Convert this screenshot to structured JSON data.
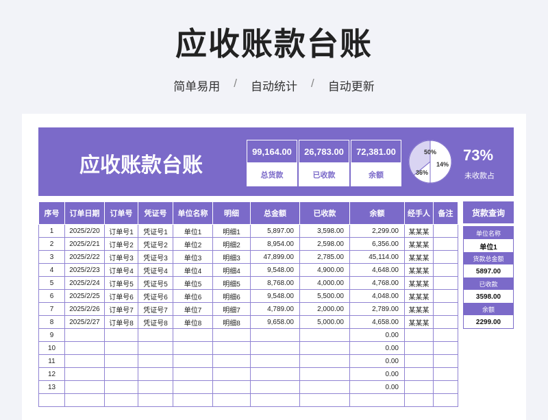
{
  "page": {
    "title": "应收账款台账",
    "subtitle": [
      "简单易用",
      "/",
      "自动统计",
      "/",
      "自动更新"
    ]
  },
  "colors": {
    "accent": "#7b6ac9",
    "grid": "#8f82d2",
    "pie_light": "#d9d4f2"
  },
  "banner": {
    "title": "应收账款台账",
    "stats": [
      {
        "value": "99,164.00",
        "label": "总货款"
      },
      {
        "value": "26,783.00",
        "label": "已收款"
      },
      {
        "value": "72,381.00",
        "label": "余额"
      }
    ],
    "pie": {
      "slices": [
        {
          "label": "50%",
          "value": 50
        },
        {
          "label": "14%",
          "value": 14
        },
        {
          "label": "36%",
          "value": 36
        }
      ]
    },
    "percent": "73%",
    "percent_label": "未收款占"
  },
  "table": {
    "headers": [
      "序号",
      "订单日期",
      "订单号",
      "凭证号",
      "单位名称",
      "明细",
      "总金额",
      "已收款",
      "余额",
      "经手人",
      "备注"
    ],
    "rows": [
      [
        "1",
        "2025/2/20",
        "订单号1",
        "凭证号1",
        "单位1",
        "明细1",
        "5,897.00",
        "3,598.00",
        "2,299.00",
        "某某某",
        ""
      ],
      [
        "2",
        "2025/2/21",
        "订单号2",
        "凭证号2",
        "单位2",
        "明细2",
        "8,954.00",
        "2,598.00",
        "6,356.00",
        "某某某",
        ""
      ],
      [
        "3",
        "2025/2/22",
        "订单号3",
        "凭证号3",
        "单位3",
        "明细3",
        "47,899.00",
        "2,785.00",
        "45,114.00",
        "某某某",
        ""
      ],
      [
        "4",
        "2025/2/23",
        "订单号4",
        "凭证号4",
        "单位4",
        "明细4",
        "9,548.00",
        "4,900.00",
        "4,648.00",
        "某某某",
        ""
      ],
      [
        "5",
        "2025/2/24",
        "订单号5",
        "凭证号5",
        "单位5",
        "明细5",
        "8,768.00",
        "4,000.00",
        "4,768.00",
        "某某某",
        ""
      ],
      [
        "6",
        "2025/2/25",
        "订单号6",
        "凭证号6",
        "单位6",
        "明细6",
        "9,548.00",
        "5,500.00",
        "4,048.00",
        "某某某",
        ""
      ],
      [
        "7",
        "2025/2/26",
        "订单号7",
        "凭证号7",
        "单位7",
        "明细7",
        "4,789.00",
        "2,000.00",
        "2,789.00",
        "某某某",
        ""
      ],
      [
        "8",
        "2025/2/27",
        "订单号8",
        "凭证号8",
        "单位8",
        "明细8",
        "9,658.00",
        "5,000.00",
        "4,658.00",
        "某某某",
        ""
      ],
      [
        "9",
        "",
        "",
        "",
        "",
        "",
        "",
        "",
        "0.00",
        "",
        ""
      ],
      [
        "10",
        "",
        "",
        "",
        "",
        "",
        "",
        "",
        "0.00",
        "",
        ""
      ],
      [
        "11",
        "",
        "",
        "",
        "",
        "",
        "",
        "",
        "0.00",
        "",
        ""
      ],
      [
        "12",
        "",
        "",
        "",
        "",
        "",
        "",
        "",
        "0.00",
        "",
        ""
      ],
      [
        "13",
        "",
        "",
        "",
        "",
        "",
        "",
        "",
        "0.00",
        "",
        ""
      ],
      [
        "",
        "",
        "",
        "",
        "",
        "",
        "",
        "",
        "",
        "",
        ""
      ]
    ]
  },
  "query": {
    "title": "货款查询",
    "fields": [
      {
        "label": "单位名称",
        "value": "单位1"
      },
      {
        "label": "货款总金额",
        "value": "5897.00"
      },
      {
        "label": "已收款",
        "value": "3598.00"
      },
      {
        "label": "余额",
        "value": "2299.00"
      }
    ]
  }
}
